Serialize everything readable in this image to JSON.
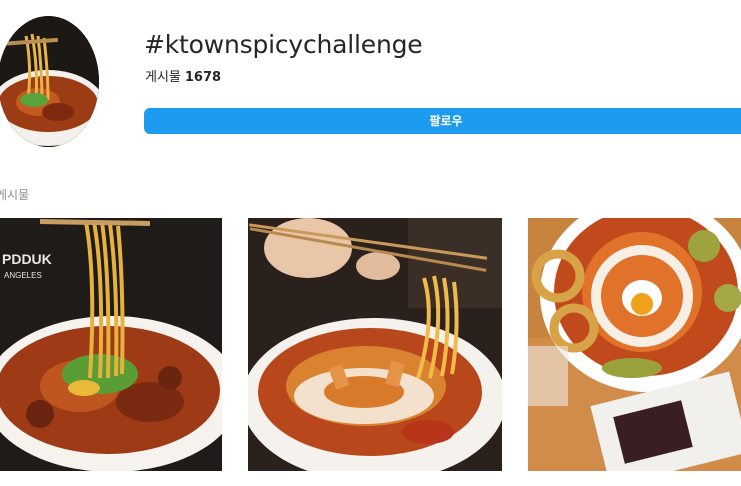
{
  "tag": {
    "title": "#ktownspicychallenge",
    "posts_label": "게시물",
    "posts_count": "1678",
    "follow_label": "팔로우"
  },
  "section": {
    "label": "게시물"
  },
  "logo_text": "PDDUK ANGELES",
  "colors": {
    "follow_button": "#1d9bf0",
    "text_primary": "#262626",
    "text_secondary": "#8e8e8e"
  }
}
